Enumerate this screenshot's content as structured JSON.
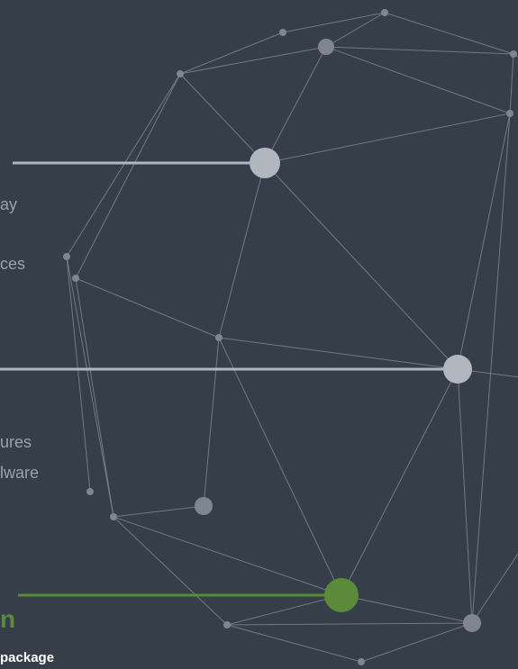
{
  "colors": {
    "background": "#363e4a",
    "edge": "#7d848f",
    "node": "#7f8692",
    "hub": "#b1b7be",
    "accent": "#5a8a3a",
    "text": "#9aa1ab"
  },
  "labels": {
    "line1": "ay",
    "line2": "ces",
    "line3": "ures",
    "line4": "lware",
    "accent_fragment": "n",
    "cta": "package"
  }
}
